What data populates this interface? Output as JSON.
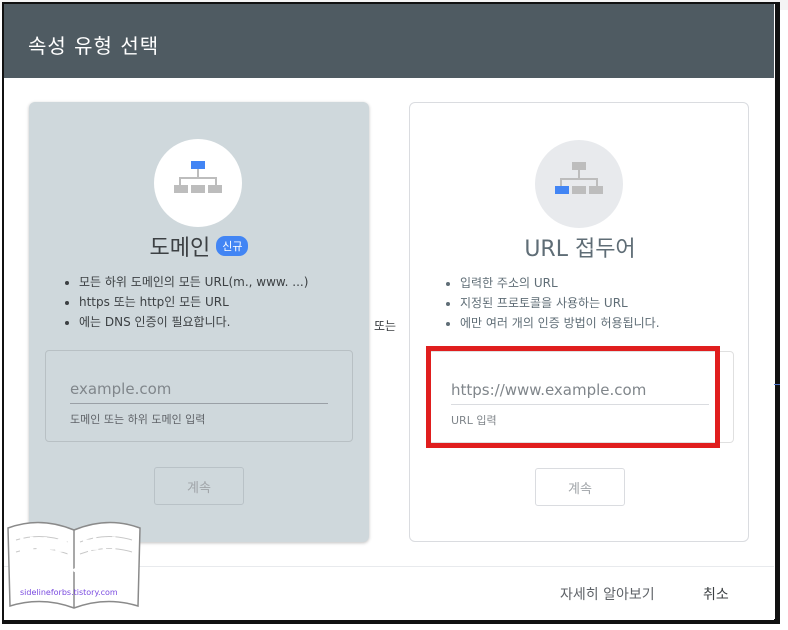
{
  "dialog": {
    "title": "속성 유형 선택"
  },
  "domain_card": {
    "heading": "도메인",
    "badge": "신규",
    "bullets": [
      "모든 하위 도메인의 모든 URL(m., www. ...)",
      "https 또는 http인 모든 URL",
      "에는 DNS 인증이 필요합니다."
    ],
    "input_placeholder": "example.com",
    "input_value": "",
    "helper": "도메인 또는 하위 도메인 입력",
    "continue_label": "계속"
  },
  "or_label": "또는",
  "url_card": {
    "heading": "URL 접두어",
    "bullets": [
      "입력한 주소의 URL",
      "지정된 프로토콜을 사용하는 URL",
      "에만 여러 개의 인증 방법이 허용됩니다."
    ],
    "input_placeholder": "https://www.example.com",
    "input_value": "",
    "helper": "URL 입력",
    "continue_label": "계속"
  },
  "footer": {
    "learn_more": "자세히 알아보기",
    "cancel": "취소"
  },
  "watermark": {
    "line1": "블슈의 부업",
    "line2": "지식창고",
    "url": "sidelineforbs.tistory.com"
  },
  "colors": {
    "header": "#4f5b62",
    "domain_card_bg": "#cfd8dc",
    "badge": "#4285f4",
    "highlight": "#e01e1e",
    "sitemap_accent": "#4285f4",
    "sitemap_grey": "#bdbdbd"
  },
  "icons": {
    "domain": "sitemap-top-highlight-icon",
    "url_prefix": "sitemap-left-highlight-icon"
  }
}
